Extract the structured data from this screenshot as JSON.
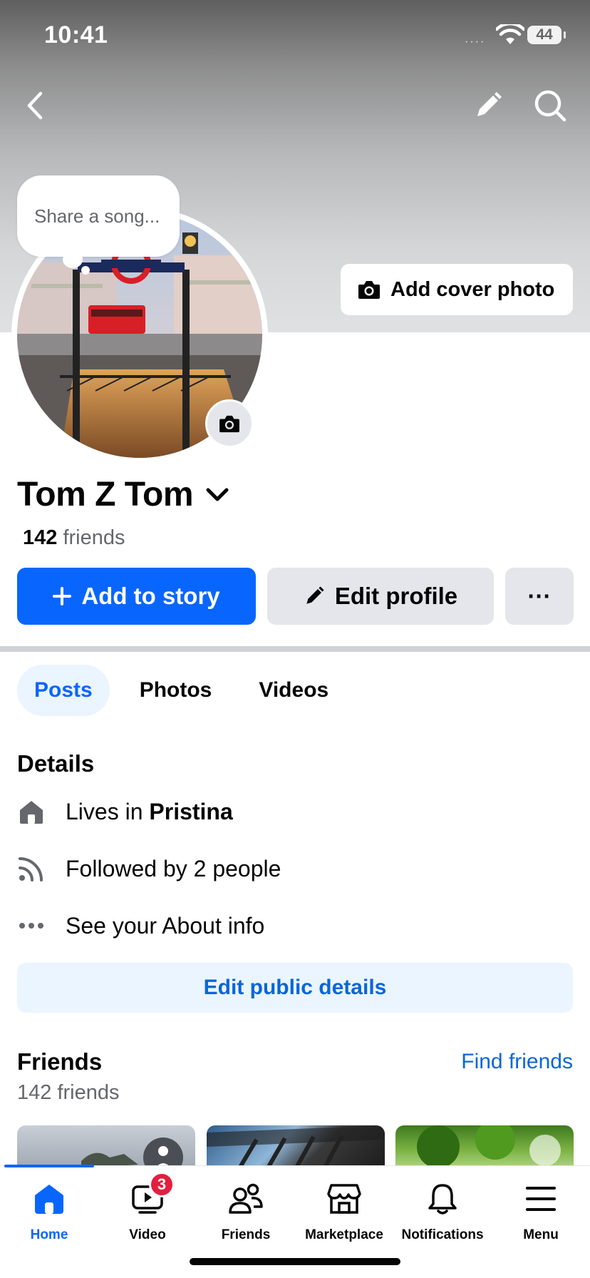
{
  "status_bar": {
    "time": "10:41",
    "battery": "44",
    "signal": "····"
  },
  "header": {
    "back_icon": "chevron-left-icon",
    "edit_icon": "pencil-icon",
    "search_icon": "search-icon"
  },
  "cover": {
    "add_cover_label": "Add cover photo"
  },
  "avatar": {
    "song_prompt": "Share a song..."
  },
  "profile": {
    "name": "Tom Z Tom",
    "friends_number": "142",
    "friends_word": "friends"
  },
  "actions": {
    "add_story": "Add to story",
    "edit_profile": "Edit profile",
    "more": "···"
  },
  "tabs": [
    {
      "label": "Posts",
      "active": true
    },
    {
      "label": "Photos",
      "active": false
    },
    {
      "label": "Videos",
      "active": false
    }
  ],
  "details": {
    "title": "Details",
    "lives_prefix": "Lives in ",
    "lives_city": "Pristina",
    "followed": "Followed by 2 people",
    "about": "See your About info",
    "edit_public": "Edit public details"
  },
  "friends": {
    "title": "Friends",
    "count_label": "142 friends",
    "find": "Find friends"
  },
  "bottom_nav": [
    {
      "label": "Home",
      "active": true
    },
    {
      "label": "Video",
      "active": false,
      "badge": "3"
    },
    {
      "label": "Friends",
      "active": false
    },
    {
      "label": "Marketplace",
      "active": false
    },
    {
      "label": "Notifications",
      "active": false
    },
    {
      "label": "Menu",
      "active": false
    }
  ],
  "colors": {
    "accent": "#0866ff",
    "accent_light": "#ebf5ff",
    "link": "#0a66d8",
    "secondary_text": "#65676b",
    "button_gray": "#e4e6eb",
    "badge": "#e41e3f"
  }
}
